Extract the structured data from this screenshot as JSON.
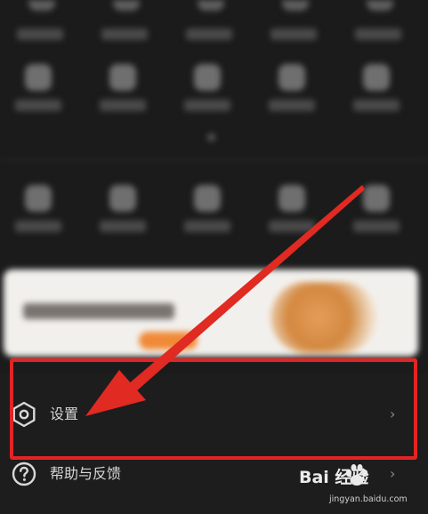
{
  "menu": {
    "items": [
      {
        "label": "设置",
        "icon": "gear-hexagon-icon",
        "chevron": "›"
      },
      {
        "label": "帮助与反馈",
        "icon": "question-circle-icon",
        "chevron": "›"
      }
    ]
  },
  "annotation": {
    "color": "#e32424"
  },
  "watermark": {
    "brand_text": "Bai 经验",
    "url": "jingyan.baidu.com",
    "icon": "paw-icon"
  }
}
